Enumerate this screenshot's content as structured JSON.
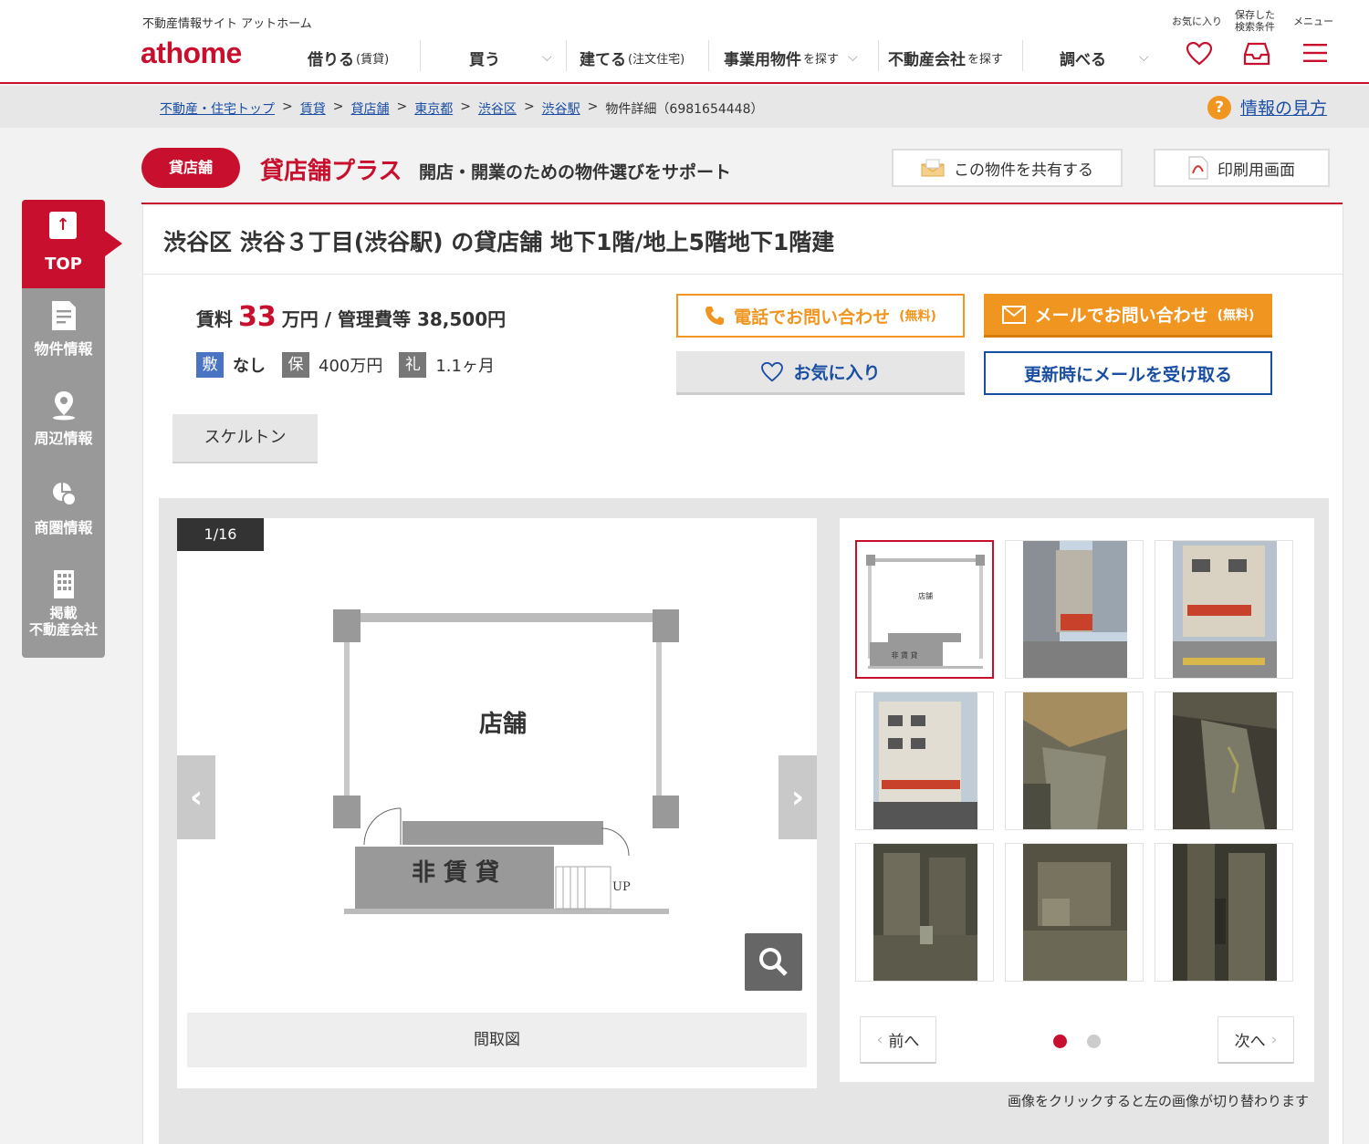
{
  "header": {
    "tagline": "不動産情報サイト アットホーム",
    "logo_text": "athome",
    "nav": [
      {
        "label": "借りる",
        "sub": "(賃貸)"
      },
      {
        "label": "買う",
        "sub": ""
      },
      {
        "label": "建てる",
        "sub": "(注文住宅)"
      },
      {
        "label": "事業用物件",
        "sub": "を探す"
      },
      {
        "label": "不動産会社",
        "sub": "を探す"
      },
      {
        "label": "調べる",
        "sub": ""
      }
    ],
    "favorites_label": "お気に入り",
    "saved_search_label_1": "保存した",
    "saved_search_label_2": "検索条件",
    "menu_label": "メニュー"
  },
  "breadcrumb": {
    "items": [
      "不動産・住宅トップ",
      "賃貸",
      "貸店舗",
      "東京都",
      "渋谷区",
      "渋谷駅"
    ],
    "separator": ">",
    "current": "物件詳細（6981654448）",
    "help_label": "情報の見方"
  },
  "promo": {
    "pill": "貸店舗",
    "title": "貸店舗プラス",
    "subtitle": "開店・開業のための物件選びをサポート",
    "share_label": "この物件を共有する",
    "print_label": "印刷用画面"
  },
  "sidenav": {
    "top_label": "TOP",
    "items": [
      {
        "label": "物件情報",
        "icon": "document-icon"
      },
      {
        "label": "周辺情報",
        "icon": "map-pin-icon"
      },
      {
        "label": "商圏情報",
        "icon": "area-chart-icon"
      },
      {
        "label": "掲載",
        "label2": "不動産会社",
        "icon": "building-icon"
      }
    ]
  },
  "property": {
    "title": "渋谷区 渋谷３丁目(渋谷駅) の貸店舗 地下1階/地上5階地下1階建",
    "rent_prefix": "賃料",
    "rent_value": "33",
    "rent_suffix": "万円 / 管理費等 38,500円",
    "deposit_badge": "敷",
    "deposit_value": "なし",
    "guarantee_badge": "保",
    "guarantee_value": "400万円",
    "keymoney_badge": "礼",
    "keymoney_value": "1.1ヶ月",
    "tag": "スケルトン"
  },
  "contact": {
    "phone_label": "電話でお問い合わせ",
    "phone_free": "(無料)",
    "mail_label": "メールでお問い合わせ",
    "mail_free": "(無料)",
    "favorite_label": "お気に入り",
    "update_label": "更新時にメールを受け取る"
  },
  "gallery": {
    "counter": "1/16",
    "caption": "間取図",
    "floorplan_room": "店舗",
    "floorplan_excluded": "非 賃 貸",
    "floorplan_up": "UP",
    "prev_label": "前へ",
    "next_label": "次へ",
    "note": "画像をクリックすると左の画像が切り替わります",
    "page_current": 1,
    "page_total": 2
  },
  "colors": {
    "brand_red": "#c8102e",
    "orange": "#f0951f",
    "link_blue": "#1a4ea3",
    "sidebar_gray": "#999999"
  }
}
